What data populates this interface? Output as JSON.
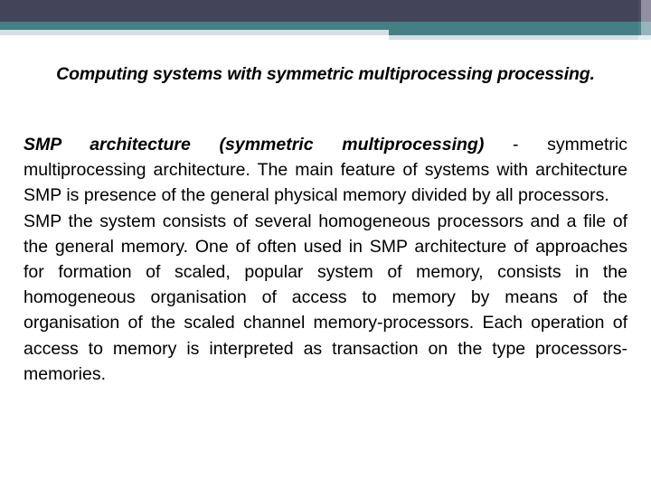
{
  "slide": {
    "title": "Computing systems with symmetric multiprocessing processing.",
    "paragraphs": [
      {
        "lead": "SMP architecture (symmetric multiprocessing)",
        "rest": " - symmetric multiprocessing architecture. The main feature of systems with architecture SMP is presence of the general physical memory divided by all processors."
      },
      {
        "lead": "",
        "rest": "SMP the system consists of several homogeneous processors and a file of the general memory. One of often used in SMP architecture of approaches for formation of scaled, popular system of memory, consists in the homogeneous organisation of access to memory by means of the organisation of the scaled channel memory-processors. Each operation of access to memory is interpreted as transaction on the type processors-memories."
      }
    ]
  },
  "decoration": {
    "band_dark_color": "#434459",
    "band_dark_accent_color": "#918fa1",
    "band_teal_color": "#447f85",
    "band_teal_accent_color": "#94b5bb",
    "band_pale_color": "#d3e0e3",
    "band_pale_accent_color": "#e4ecee",
    "page_background": "#ffffff",
    "text_color": "#000000"
  }
}
